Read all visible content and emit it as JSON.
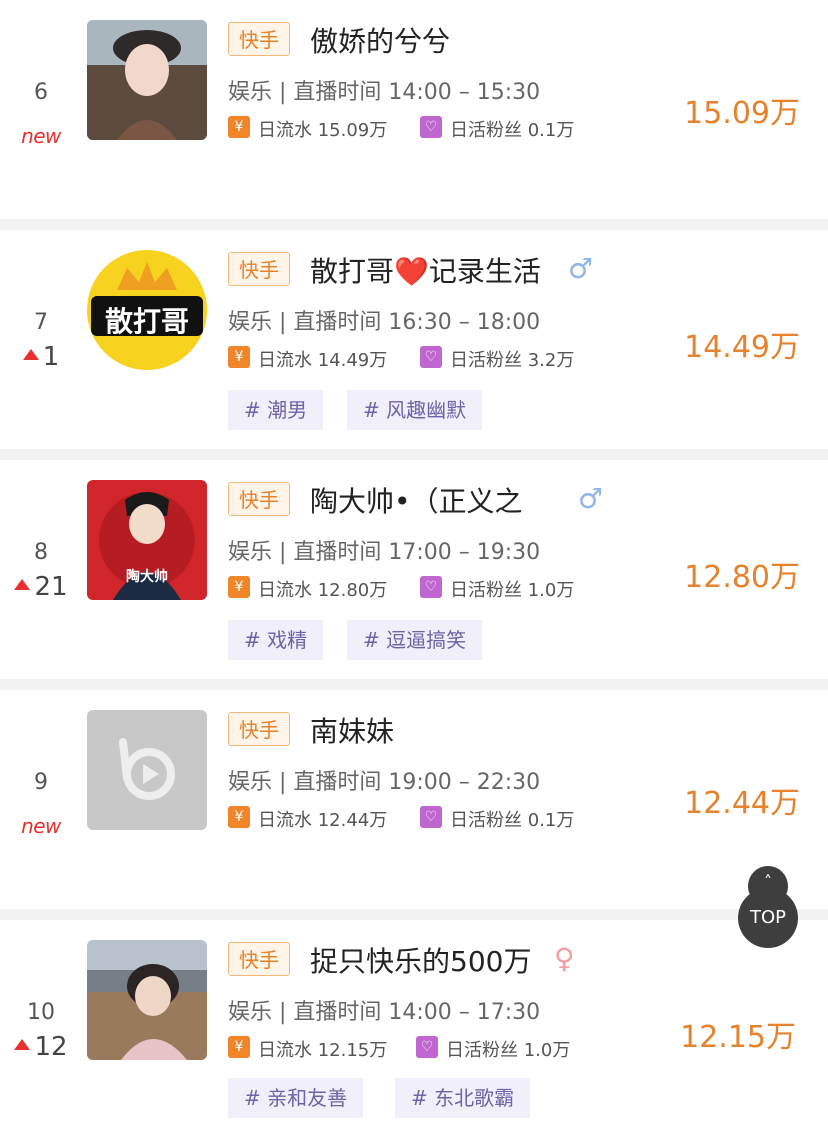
{
  "entries": [
    {
      "rank": "6",
      "rank_new": "new",
      "rank_change": "",
      "platform": "快手",
      "name": "傲娇的兮兮",
      "gender_symbol": "",
      "meta": "娱乐 | 直播时间 14:00 – 15:30",
      "revenue_label": "日流水 15.09万",
      "fans_label": "日活粉丝 0.1万",
      "value": "15.09万",
      "tags": []
    },
    {
      "rank": "7",
      "rank_new": "",
      "rank_change": "1",
      "platform": "快手",
      "name": "散打哥❤️记录生活",
      "gender_symbol": "♂",
      "meta": "娱乐 | 直播时间 16:30 – 18:00",
      "revenue_label": "日流水 14.49万",
      "fans_label": "日活粉丝 3.2万",
      "value": "14.49万",
      "tags": [
        "# 潮男",
        "# 风趣幽默"
      ],
      "avatar_text": "散打哥"
    },
    {
      "rank": "8",
      "rank_new": "",
      "rank_change": "21",
      "platform": "快手",
      "name": "陶大帅•（正义之",
      "gender_symbol": "♂",
      "meta": "娱乐 | 直播时间 17:00 – 19:30",
      "revenue_label": "日流水 12.80万",
      "fans_label": "日活粉丝 1.0万",
      "value": "12.80万",
      "tags": [
        "# 戏精",
        "# 逗逼搞笑"
      ],
      "avatar_text": "陶大帅"
    },
    {
      "rank": "9",
      "rank_new": "new",
      "rank_change": "",
      "platform": "快手",
      "name": "南妹妹",
      "gender_symbol": "",
      "meta": "娱乐 | 直播时间 19:00 – 22:30",
      "revenue_label": "日流水 12.44万",
      "fans_label": "日活粉丝 0.1万",
      "value": "12.44万",
      "tags": []
    },
    {
      "rank": "10",
      "rank_new": "",
      "rank_change": "12",
      "platform": "快手",
      "name": "捉只快乐的500万",
      "gender_symbol": "♀",
      "meta": "娱乐 | 直播时间 14:00 – 17:30",
      "revenue_label": "日流水 12.15万",
      "fans_label": "日活粉丝 1.0万",
      "value": "12.15万",
      "tags": [
        "# 亲和友善",
        "# 东北歌霸"
      ]
    }
  ],
  "icons": {
    "revenue": "yen-icon",
    "fans": "fans-icon",
    "male": "male-icon",
    "female": "female-icon"
  },
  "colors": {
    "accent": "#e6822c",
    "rank_up": "#e8312f",
    "tag_text": "#6d63a6",
    "tag_bg": "#f1effa",
    "male": "#8fb6e8",
    "female": "#f0a0a0"
  },
  "top_button": {
    "label": "TOP",
    "arrow": "˄"
  }
}
